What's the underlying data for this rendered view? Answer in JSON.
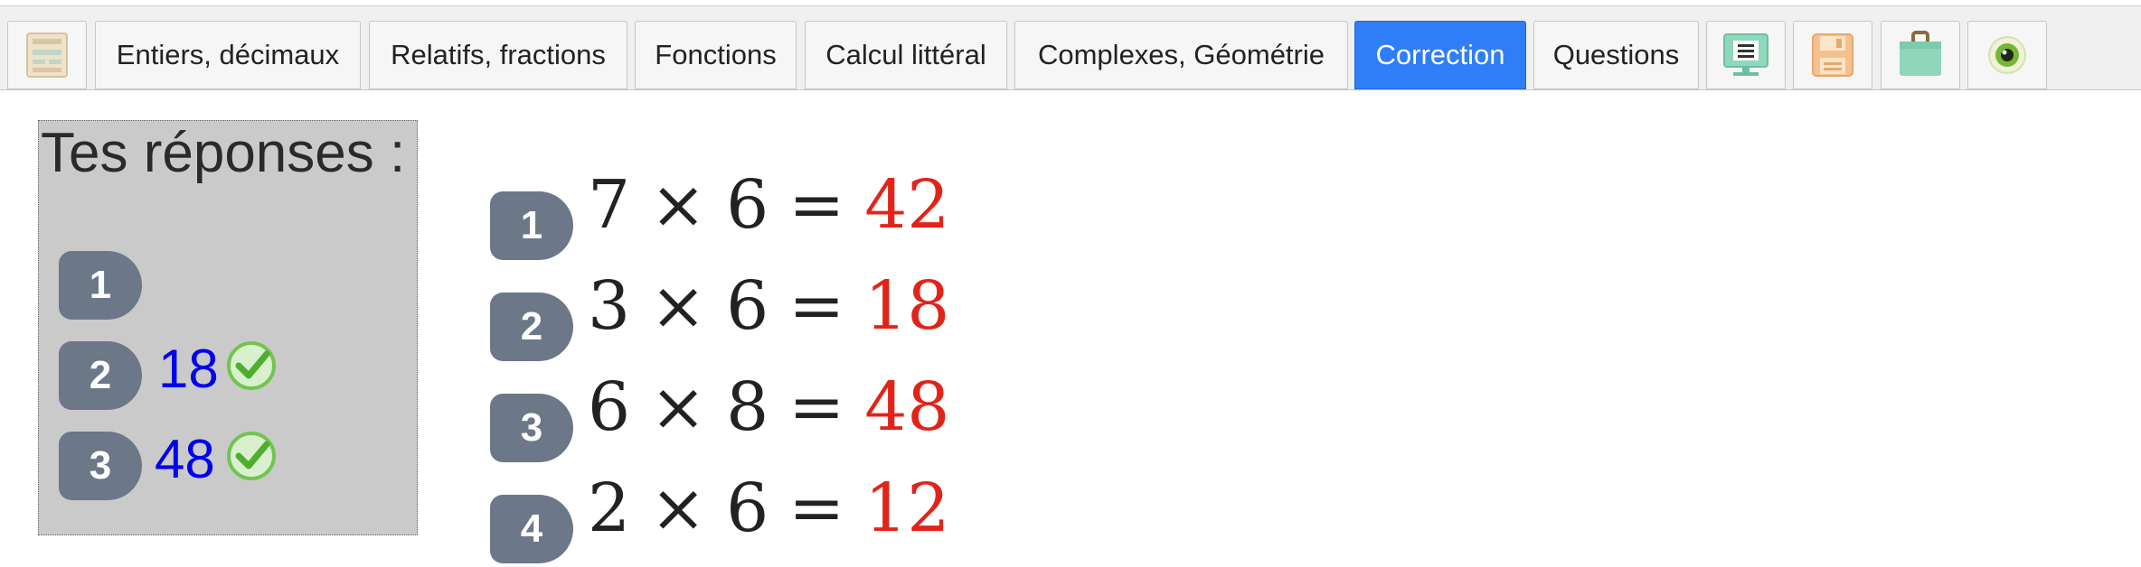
{
  "toolbar": {
    "tabs": [
      {
        "label": "Entiers, décimaux"
      },
      {
        "label": "Relatifs, fractions"
      },
      {
        "label": "Fonctions"
      },
      {
        "label": "Calcul littéral"
      },
      {
        "label": "Complexes, Géométrie"
      },
      {
        "label": "Correction",
        "active": true
      },
      {
        "label": "Questions"
      }
    ],
    "icons": [
      "document-icon",
      "presentation-icon",
      "save-icon",
      "briefcase-icon",
      "eye-icon"
    ],
    "active_color": "#2f7ef8"
  },
  "answers_panel": {
    "title": "Tes réponses :",
    "items": [
      {
        "number": "1",
        "value": "",
        "correct": false
      },
      {
        "number": "2",
        "value": "18",
        "correct": true
      },
      {
        "number": "3",
        "value": "48",
        "correct": true
      }
    ]
  },
  "correction": {
    "items": [
      {
        "number": "1",
        "a": "7",
        "op": "×",
        "b": "6",
        "eq": "=",
        "result": "42"
      },
      {
        "number": "2",
        "a": "3",
        "op": "×",
        "b": "6",
        "eq": "=",
        "result": "18"
      },
      {
        "number": "3",
        "a": "6",
        "op": "×",
        "b": "8",
        "eq": "=",
        "result": "48"
      },
      {
        "number": "4",
        "a": "2",
        "op": "×",
        "b": "6",
        "eq": "=",
        "result": "12"
      }
    ],
    "result_color": "#e1241a"
  }
}
